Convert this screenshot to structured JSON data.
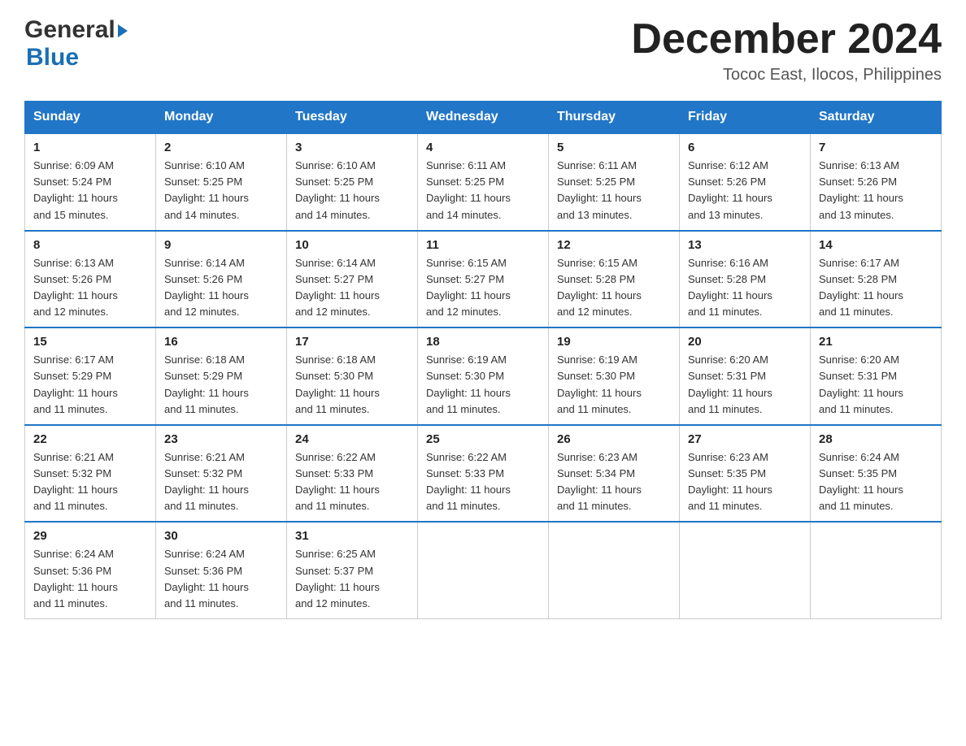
{
  "header": {
    "logo_line1": "General",
    "logo_line2": "Blue",
    "month_year": "December 2024",
    "location": "Tococ East, Ilocos, Philippines"
  },
  "days_of_week": [
    "Sunday",
    "Monday",
    "Tuesday",
    "Wednesday",
    "Thursday",
    "Friday",
    "Saturday"
  ],
  "weeks": [
    [
      {
        "day": "1",
        "sunrise": "6:09 AM",
        "sunset": "5:24 PM",
        "daylight": "11 hours and 15 minutes."
      },
      {
        "day": "2",
        "sunrise": "6:10 AM",
        "sunset": "5:25 PM",
        "daylight": "11 hours and 14 minutes."
      },
      {
        "day": "3",
        "sunrise": "6:10 AM",
        "sunset": "5:25 PM",
        "daylight": "11 hours and 14 minutes."
      },
      {
        "day": "4",
        "sunrise": "6:11 AM",
        "sunset": "5:25 PM",
        "daylight": "11 hours and 14 minutes."
      },
      {
        "day": "5",
        "sunrise": "6:11 AM",
        "sunset": "5:25 PM",
        "daylight": "11 hours and 13 minutes."
      },
      {
        "day": "6",
        "sunrise": "6:12 AM",
        "sunset": "5:26 PM",
        "daylight": "11 hours and 13 minutes."
      },
      {
        "day": "7",
        "sunrise": "6:13 AM",
        "sunset": "5:26 PM",
        "daylight": "11 hours and 13 minutes."
      }
    ],
    [
      {
        "day": "8",
        "sunrise": "6:13 AM",
        "sunset": "5:26 PM",
        "daylight": "11 hours and 12 minutes."
      },
      {
        "day": "9",
        "sunrise": "6:14 AM",
        "sunset": "5:26 PM",
        "daylight": "11 hours and 12 minutes."
      },
      {
        "day": "10",
        "sunrise": "6:14 AM",
        "sunset": "5:27 PM",
        "daylight": "11 hours and 12 minutes."
      },
      {
        "day": "11",
        "sunrise": "6:15 AM",
        "sunset": "5:27 PM",
        "daylight": "11 hours and 12 minutes."
      },
      {
        "day": "12",
        "sunrise": "6:15 AM",
        "sunset": "5:28 PM",
        "daylight": "11 hours and 12 minutes."
      },
      {
        "day": "13",
        "sunrise": "6:16 AM",
        "sunset": "5:28 PM",
        "daylight": "11 hours and 11 minutes."
      },
      {
        "day": "14",
        "sunrise": "6:17 AM",
        "sunset": "5:28 PM",
        "daylight": "11 hours and 11 minutes."
      }
    ],
    [
      {
        "day": "15",
        "sunrise": "6:17 AM",
        "sunset": "5:29 PM",
        "daylight": "11 hours and 11 minutes."
      },
      {
        "day": "16",
        "sunrise": "6:18 AM",
        "sunset": "5:29 PM",
        "daylight": "11 hours and 11 minutes."
      },
      {
        "day": "17",
        "sunrise": "6:18 AM",
        "sunset": "5:30 PM",
        "daylight": "11 hours and 11 minutes."
      },
      {
        "day": "18",
        "sunrise": "6:19 AM",
        "sunset": "5:30 PM",
        "daylight": "11 hours and 11 minutes."
      },
      {
        "day": "19",
        "sunrise": "6:19 AM",
        "sunset": "5:30 PM",
        "daylight": "11 hours and 11 minutes."
      },
      {
        "day": "20",
        "sunrise": "6:20 AM",
        "sunset": "5:31 PM",
        "daylight": "11 hours and 11 minutes."
      },
      {
        "day": "21",
        "sunrise": "6:20 AM",
        "sunset": "5:31 PM",
        "daylight": "11 hours and 11 minutes."
      }
    ],
    [
      {
        "day": "22",
        "sunrise": "6:21 AM",
        "sunset": "5:32 PM",
        "daylight": "11 hours and 11 minutes."
      },
      {
        "day": "23",
        "sunrise": "6:21 AM",
        "sunset": "5:32 PM",
        "daylight": "11 hours and 11 minutes."
      },
      {
        "day": "24",
        "sunrise": "6:22 AM",
        "sunset": "5:33 PM",
        "daylight": "11 hours and 11 minutes."
      },
      {
        "day": "25",
        "sunrise": "6:22 AM",
        "sunset": "5:33 PM",
        "daylight": "11 hours and 11 minutes."
      },
      {
        "day": "26",
        "sunrise": "6:23 AM",
        "sunset": "5:34 PM",
        "daylight": "11 hours and 11 minutes."
      },
      {
        "day": "27",
        "sunrise": "6:23 AM",
        "sunset": "5:35 PM",
        "daylight": "11 hours and 11 minutes."
      },
      {
        "day": "28",
        "sunrise": "6:24 AM",
        "sunset": "5:35 PM",
        "daylight": "11 hours and 11 minutes."
      }
    ],
    [
      {
        "day": "29",
        "sunrise": "6:24 AM",
        "sunset": "5:36 PM",
        "daylight": "11 hours and 11 minutes."
      },
      {
        "day": "30",
        "sunrise": "6:24 AM",
        "sunset": "5:36 PM",
        "daylight": "11 hours and 11 minutes."
      },
      {
        "day": "31",
        "sunrise": "6:25 AM",
        "sunset": "5:37 PM",
        "daylight": "11 hours and 12 minutes."
      },
      null,
      null,
      null,
      null
    ]
  ],
  "labels": {
    "sunrise_prefix": "Sunrise: ",
    "sunset_prefix": "Sunset: ",
    "daylight_prefix": "Daylight: "
  }
}
